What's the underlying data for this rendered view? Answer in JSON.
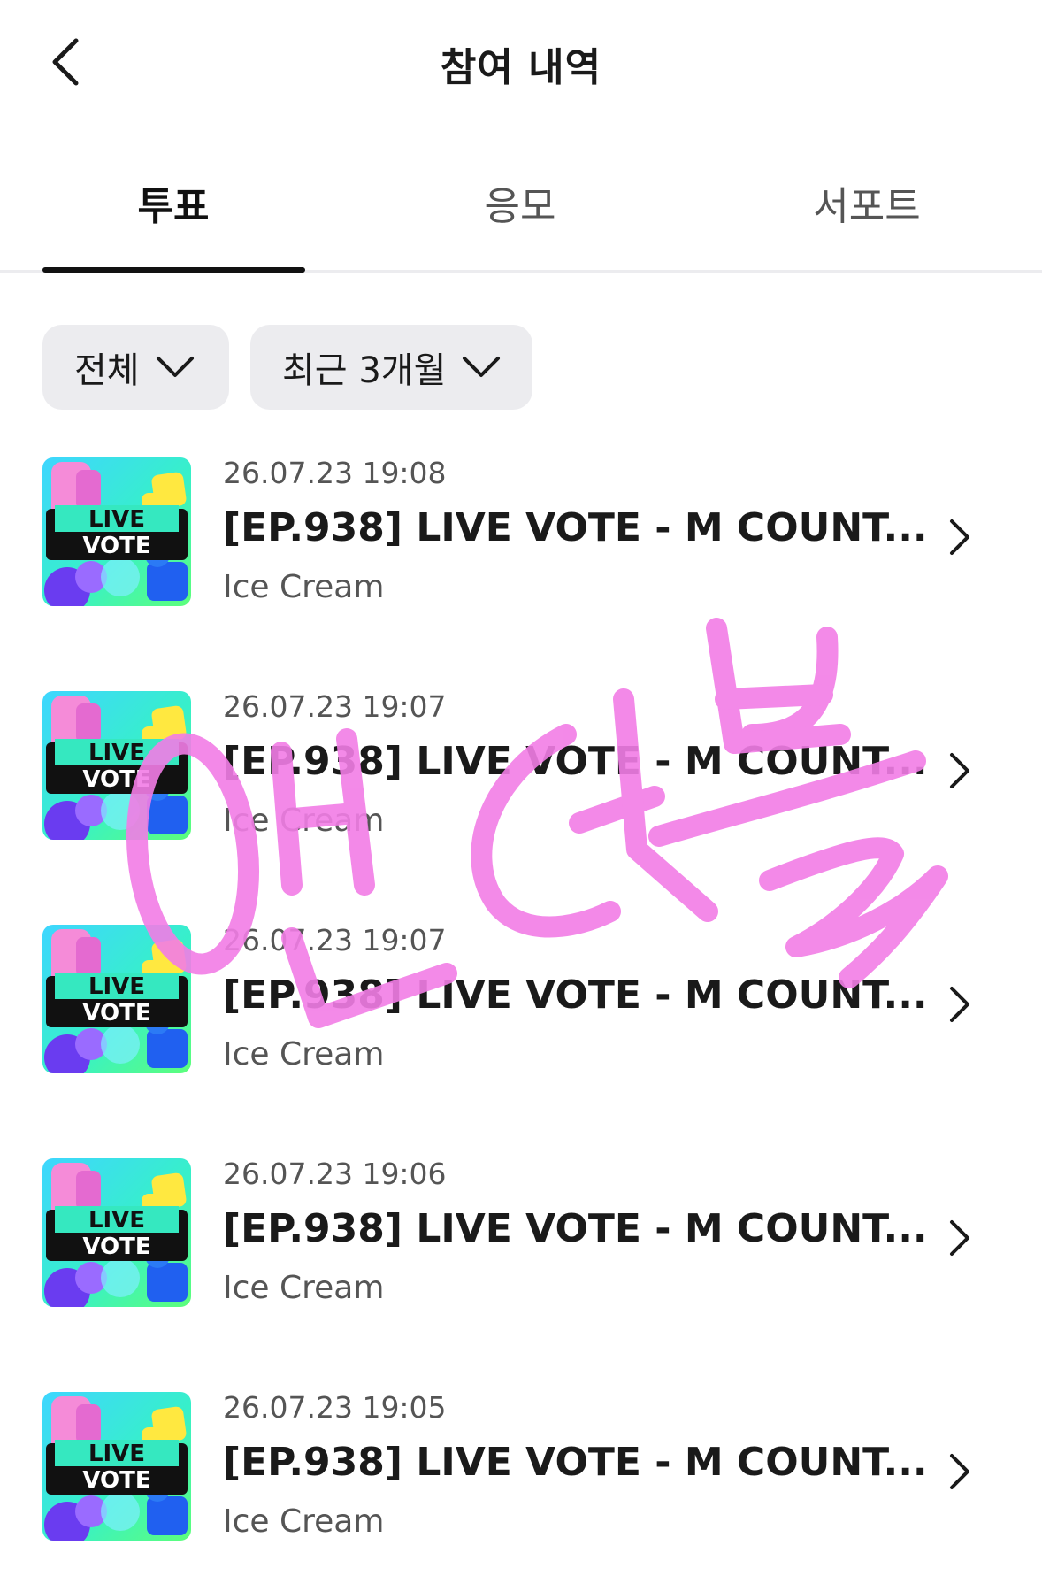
{
  "header": {
    "title": "참여 내역",
    "back_icon": "chevron-left-icon"
  },
  "tabs": [
    {
      "label": "투표",
      "active": true
    },
    {
      "label": "응모",
      "active": false
    },
    {
      "label": "서포트",
      "active": false
    }
  ],
  "filters": {
    "category": "전체",
    "period": "최근 3개월"
  },
  "items": [
    {
      "date": "26.07.23 19:08",
      "title": "[EP.938] LIVE VOTE - M COUNT...",
      "subtitle": "Ice Cream",
      "thumb_text_1": "LIVE",
      "thumb_text_2": "VOTE"
    },
    {
      "date": "26.07.23 19:07",
      "title": "[EP.938] LIVE VOTE - M COUNT...",
      "subtitle": "Ice Cream",
      "thumb_text_1": "LIVE",
      "thumb_text_2": "VOTE"
    },
    {
      "date": "26.07.23 19:07",
      "title": "[EP.938] LIVE VOTE - M COUNT...",
      "subtitle": "Ice Cream",
      "thumb_text_1": "LIVE",
      "thumb_text_2": "VOTE"
    },
    {
      "date": "26.07.23 19:06",
      "title": "[EP.938] LIVE VOTE - M COUNT...",
      "subtitle": "Ice Cream",
      "thumb_text_1": "LIVE",
      "thumb_text_2": "VOTE"
    },
    {
      "date": "26.07.23 19:05",
      "title": "[EP.938] LIVE VOTE - M COUNT...",
      "subtitle": "Ice Cream",
      "thumb_text_1": "LIVE",
      "thumb_text_2": "VOTE"
    }
  ],
  "colors": {
    "watermark": "#f27de6",
    "tab_underline": "#111111",
    "filter_bg": "#ececef"
  }
}
